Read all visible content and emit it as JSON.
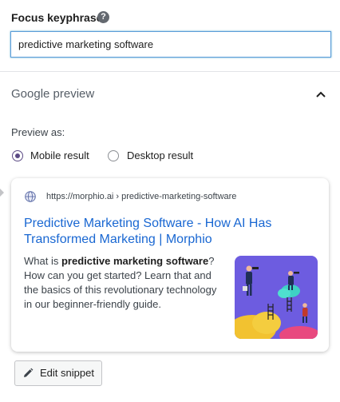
{
  "focus_keyphrase": {
    "label": "Focus keyphrase",
    "help_icon": "question-mark-icon",
    "help_glyph": "?",
    "value": "predictive marketing software"
  },
  "google_preview": {
    "title": "Google preview",
    "collapse_icon": "chevron-up-icon",
    "preview_as_label": "Preview as:",
    "options": [
      {
        "label": "Mobile result",
        "selected": true
      },
      {
        "label": "Desktop result",
        "selected": false
      }
    ],
    "result": {
      "favicon": "globe-icon",
      "url": "https://morphio.ai › predictive-marketing-software",
      "title": "Predictive Marketing Software - How AI Has Transformed Marketing | Morphio",
      "snippet_pre": "What is ",
      "snippet_bold": "predictive marketing software",
      "snippet_post": "? How can you get started? Learn that and the basics of this revolutionary technology in our beginner-friendly guide.",
      "thumbnail": "marketing-illustration-image"
    },
    "edit_button": {
      "icon": "pencil-icon",
      "label": "Edit snippet"
    }
  },
  "colors": {
    "link": "#1967d2",
    "radio_selected": "#5b4a84",
    "input_focus_border": "#5b9dd9",
    "thumbnail_bg": "#6d5ce0"
  }
}
